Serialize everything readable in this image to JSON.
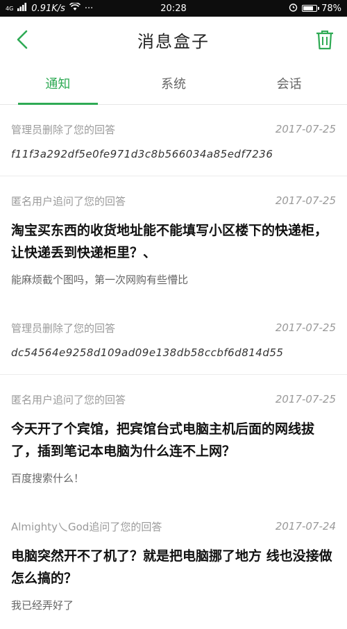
{
  "status_bar": {
    "signal_label": "4G",
    "speed": "0.91K/s",
    "more": "···",
    "time": "20:28",
    "battery": "78%",
    "battery_level": 0.78
  },
  "header": {
    "title": "消息盒子",
    "back_icon": "chevron-left-icon",
    "delete_icon": "trash-icon",
    "accent_color": "#2eaa54"
  },
  "tabs": [
    {
      "label": "通知",
      "active": true
    },
    {
      "label": "系统",
      "active": false
    },
    {
      "label": "会话",
      "active": false
    }
  ],
  "items": [
    {
      "title": "管理员删除了您的回答",
      "date": "2017-07-25",
      "hash": "f11f3a292df5e0fe971d3c8b566034a85edf7236"
    },
    {
      "title": "匿名用户追问了您的回答",
      "date": "2017-07-25",
      "question": "淘宝买东西的收货地址能不能填写小区楼下的快递柜，让快递丢到快递柜里？、",
      "reply": "能麻烦截个图吗，第一次网购有些懵比"
    },
    {
      "title": "管理员删除了您的回答",
      "date": "2017-07-25",
      "hash": "dc54564e9258d109ad09e138db58ccbf6d814d55"
    },
    {
      "title": "匿名用户追问了您的回答",
      "date": "2017-07-25",
      "question": "今天开了个宾馆，把宾馆台式电脑主机后面的网线拔了，插到笔记本电脑为什么连不上网？",
      "reply": "百度搜索什么！"
    },
    {
      "title": "Almighty乀God追问了您的回答",
      "date": "2017-07-24",
      "question": "电脑突然开不了机了？就是把电脑挪了地方 线也没接做 怎么搞的？",
      "reply": "我已经弄好了"
    }
  ]
}
